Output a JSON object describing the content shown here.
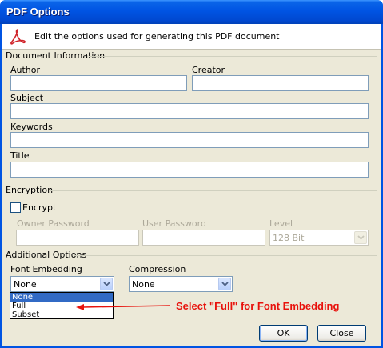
{
  "window": {
    "title": "PDF Options"
  },
  "header": {
    "text": "Edit the options used for generating this PDF document"
  },
  "document_information": {
    "group_label": "Document Information",
    "author_label": "Author",
    "author_value": "",
    "creator_label": "Creator",
    "creator_value": "",
    "subject_label": "Subject",
    "subject_value": "",
    "keywords_label": "Keywords",
    "keywords_value": "",
    "title_label": "Title",
    "title_value": ""
  },
  "encryption": {
    "group_label": "Encryption",
    "encrypt_label": "Encrypt",
    "encrypt_checked": false,
    "owner_password_label": "Owner Password",
    "owner_password_value": "",
    "user_password_label": "User Password",
    "user_password_value": "",
    "level_label": "Level",
    "level_value": "128 Bit"
  },
  "additional_options": {
    "group_label": "Additional Options",
    "font_embedding_label": "Font Embedding",
    "font_embedding_value": "None",
    "font_embedding_options": [
      "None",
      "Full",
      "Subset"
    ],
    "font_embedding_highlighted": "None",
    "compression_label": "Compression",
    "compression_value": "None"
  },
  "annotation": {
    "text": "Select \"Full\" for Font Embedding",
    "color": "#e8120c"
  },
  "buttons": {
    "ok_label": "OK",
    "close_label": "Close"
  },
  "colors": {
    "titlebar": "#0054e3",
    "dialog_bg": "#ece9d8",
    "selection": "#316ac5"
  }
}
